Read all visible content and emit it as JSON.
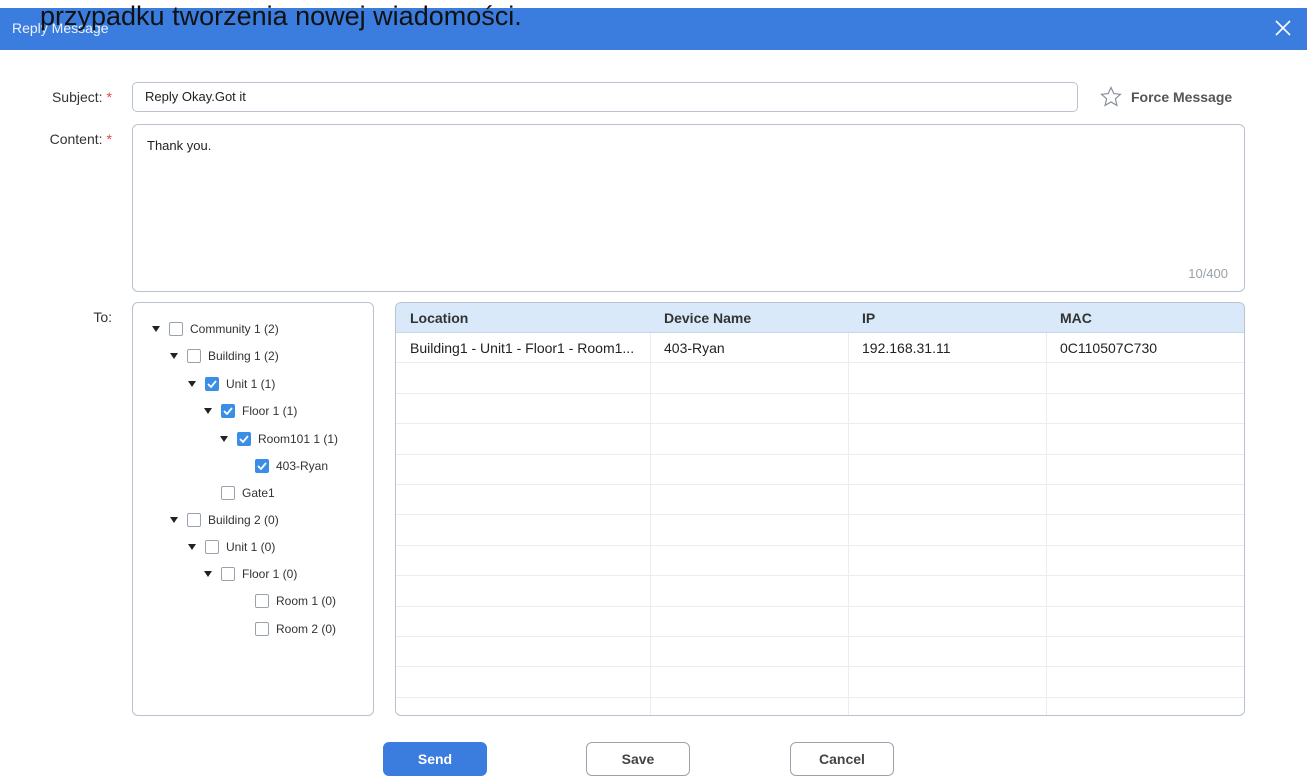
{
  "overlay": {
    "text": "przypadku tworzenia nowej wiadomości."
  },
  "dialog": {
    "title": "Reply Message"
  },
  "form": {
    "subject_label": "Subject:",
    "content_label": "Content:",
    "to_label": "To:",
    "required_mark": "*",
    "subject_value": "Reply Okay.Got it",
    "content_value": "Thank you.",
    "char_count": "10/400",
    "force_message_label": "Force Message"
  },
  "tree": [
    {
      "label": "Community 1 (2)",
      "checked": false,
      "expandable": true
    },
    {
      "label": "Building 1 (2)",
      "checked": false,
      "expandable": true
    },
    {
      "label": "Unit 1 (1)",
      "checked": true,
      "expandable": true
    },
    {
      "label": "Floor 1 (1)",
      "checked": true,
      "expandable": true
    },
    {
      "label": "Room101 1 (1)",
      "checked": true,
      "expandable": true
    },
    {
      "label": "403-Ryan",
      "checked": true,
      "expandable": false
    },
    {
      "label": "Gate1",
      "checked": false,
      "expandable": false
    },
    {
      "label": "Building 2 (0)",
      "checked": false,
      "expandable": true
    },
    {
      "label": "Unit 1 (0)",
      "checked": false,
      "expandable": true
    },
    {
      "label": "Floor 1 (0)",
      "checked": false,
      "expandable": true
    },
    {
      "label": "Room 1 (0)",
      "checked": false,
      "expandable": false
    },
    {
      "label": "Room 2 (0)",
      "checked": false,
      "expandable": false
    }
  ],
  "table": {
    "columns": [
      "Location",
      "Device Name",
      "IP",
      "MAC"
    ],
    "rows": [
      [
        "Building1 - Unit1 - Floor1 - Room1...",
        "403-Ryan",
        "192.168.31.11",
        "0C110507C730"
      ]
    ]
  },
  "buttons": {
    "send": "Send",
    "save": "Save",
    "cancel": "Cancel"
  },
  "colors": {
    "accent": "#3b7dde",
    "checkbox_checked": "#3a8ee6",
    "header_bg": "#d9e9fa",
    "required": "#e04848"
  }
}
